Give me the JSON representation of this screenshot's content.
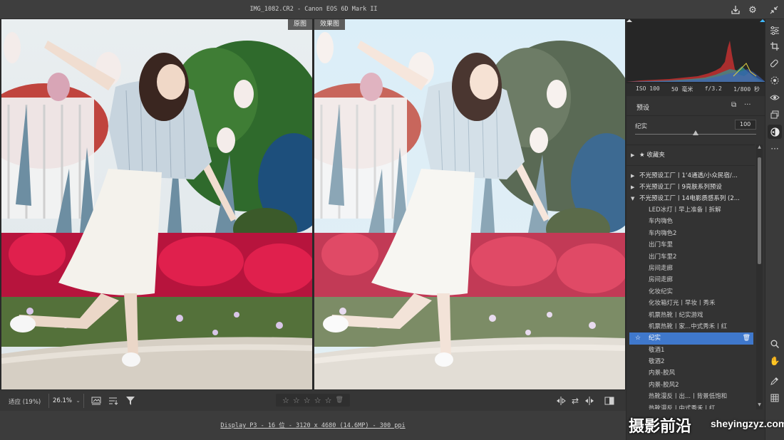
{
  "window": {
    "title": "IMG_1082.CR2 -  Canon EOS 6D Mark II"
  },
  "views": {
    "before_label": "原图",
    "after_label": "效果图"
  },
  "bottom_toolbar": {
    "zoom_fit": "适应 (19%)",
    "zoom_value": "26.1%",
    "rating_stars": 5
  },
  "status_line": {
    "text": "Display P3 - 16 位 - 3120 x 4680 (14.6MP) - 300 ppi"
  },
  "exif": {
    "iso": "ISO 100",
    "focal": "50 毫米",
    "aperture": "f/3.2",
    "shutter": "1/800 秒"
  },
  "presets": {
    "title": "预设",
    "amount_label": "纪实",
    "amount_value": "100",
    "amount_fraction": 1.0,
    "favorites": "收藏夹",
    "groups": [
      {
        "label": "不光预设工厂丨1‘4通透/小众民宿/..."
      },
      {
        "label": "不光预设工厂丨9亮肤系列预设"
      },
      {
        "label": "不光预设工厂丨14电影质感系列 (2..."
      }
    ],
    "items": [
      "LED冰灯丨早上准备丨拆解",
      "车内嗨色",
      "车内嗨色2",
      "出门车里",
      "出门车里2",
      "房间走廊",
      "房间走廊",
      "化妆纪实",
      "化妆箱灯光丨早妆丨秀禾",
      "机票热靴丨纪实游戏",
      "机票热靴丨家...中式秀禾丨红"
    ],
    "selected": "纪实",
    "items_after": [
      "敬酒1",
      "敬酒2",
      "内景-胶风",
      "内景-胶风2",
      "热靴漫反丨出...丨背景低饱和",
      "热靴漫反丨中式秀禾丨红"
    ]
  },
  "watermark": {
    "cn": "摄影前沿",
    "en": "sheyingzyz.com"
  },
  "colors": {
    "accent": "#3f78cc",
    "panel": "#333333",
    "viewer": "#2a2a2a"
  }
}
